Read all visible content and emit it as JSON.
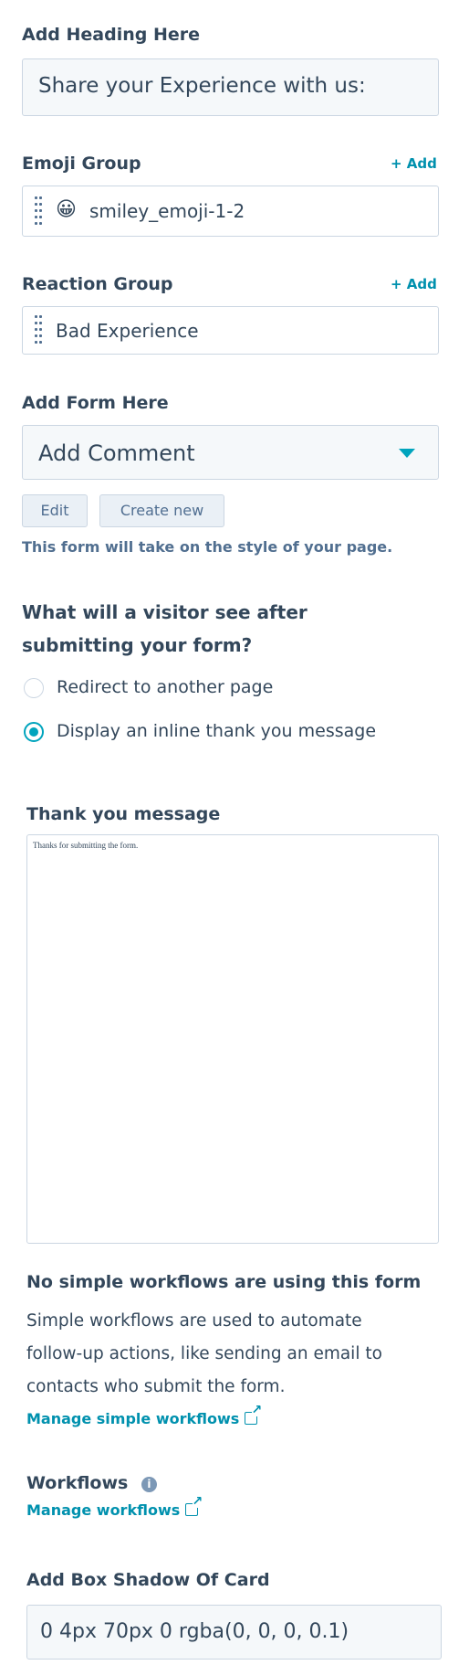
{
  "heading": {
    "label": "Add Heading Here",
    "value": "Share your Experience with us:"
  },
  "emoji_group": {
    "label": "Emoji Group",
    "add": "+ Add",
    "item": "smiley_emoji-1-2",
    "emoji": "😀"
  },
  "reaction_group": {
    "label": "Reaction Group",
    "add": "+ Add",
    "item": "Bad Experience"
  },
  "form": {
    "label": "Add Form Here",
    "selected": "Add Comment",
    "edit": "Edit",
    "create_new": "Create new",
    "note": "This form will take on the style of your page."
  },
  "after_submit": {
    "question": "What will a visitor see after submitting your form?",
    "options": [
      "Redirect to another page",
      "Display an inline thank you message"
    ],
    "selected_index": 1
  },
  "thank_you": {
    "label": "Thank you message",
    "text": "Thanks for submitting the form."
  },
  "simple_workflows": {
    "title": "No simple workflows are using this form",
    "desc": "Simple workflows are used to automate follow-up actions, like sending an email to contacts who submit the form.",
    "link": "Manage simple workflows"
  },
  "workflows": {
    "label": "Workflows",
    "link": "Manage workflows"
  },
  "box_shadow": {
    "label": "Add Box Shadow Of Card",
    "value": "0 4px 70px 0 rgba(0, 0, 0, 0.1)"
  },
  "colors": {
    "accent": "#00a4bd",
    "link": "#0091ae",
    "text": "#33475b",
    "field_bg": "#f5f8fa",
    "border": "#cbd6e2"
  }
}
